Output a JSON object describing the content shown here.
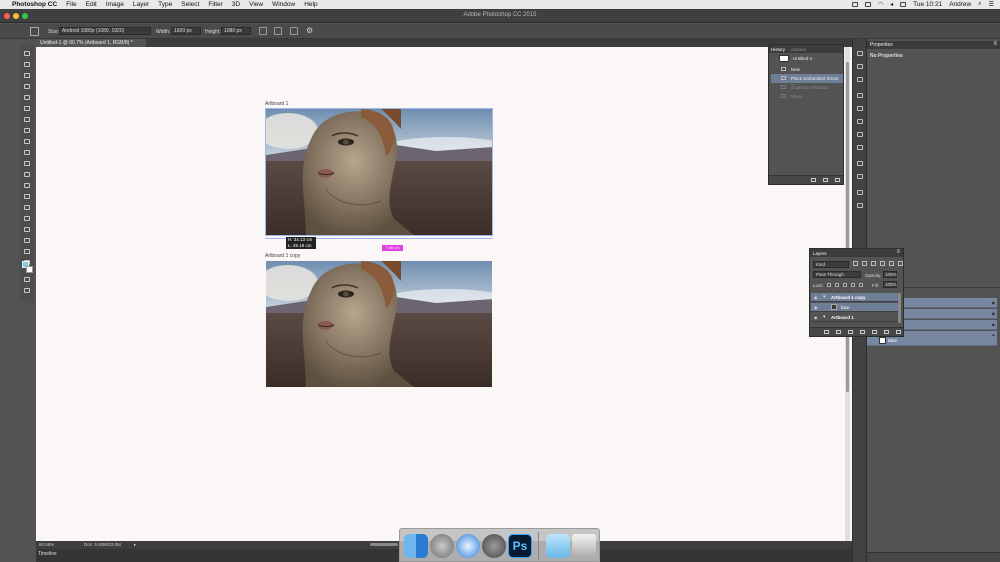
{
  "menubar": {
    "apple_icon": "apple-logo-icon",
    "items": [
      "Photoshop CC",
      "File",
      "Edit",
      "Image",
      "Layer",
      "Type",
      "Select",
      "Filter",
      "3D",
      "View",
      "Window",
      "Help"
    ],
    "clock": "Tue 10:21",
    "user": "Andrew"
  },
  "window": {
    "title": "Adobe Photoshop CC 2015",
    "traffic_colors": [
      "#fc605c",
      "#fdbc40",
      "#34c84a"
    ]
  },
  "options_bar": {
    "size_label": "Size:",
    "size_value": "Android 1080p (1080, 1920)",
    "width_label": "Width:",
    "width_value": "1920 px",
    "height_label": "Height:",
    "height_value": "1080 px"
  },
  "document_tab": {
    "title": "Untitled-1 @ 60.7% (Artboard 1, RGB/8) *"
  },
  "canvas": {
    "artboard1_label": "Artboard 1",
    "artboard2_label": "Artboard 1 copy",
    "measure_line1": "H: 34.13 cm",
    "measure_line2": "L: 45.19 cm",
    "guide_label": "7.06 cm",
    "selection_color": "#9fb7e8",
    "guide_color": "#e23ee2"
  },
  "history": {
    "tab_history": "History",
    "tab_actions": "Actions",
    "snapshot": "Untitled-1",
    "items": [
      {
        "label": "New",
        "state": "normal"
      },
      {
        "label": "Place Embedded Smart ...",
        "state": "selected"
      },
      {
        "label": "Duplicate Artboard",
        "state": "dim"
      },
      {
        "label": "Move",
        "state": "dim"
      }
    ]
  },
  "layers": {
    "title": "Layers",
    "kind": "Kind",
    "blend_mode": "Pass Through",
    "opacity_label": "Opacity:",
    "opacity_value": "100%",
    "lock_label": "Lock:",
    "fill_label": "Fill:",
    "fill_value": "100%",
    "rows": [
      {
        "label": "Artboard 1 copy",
        "selected": true,
        "type": "group"
      },
      {
        "label": "face",
        "selected": true,
        "type": "smart"
      },
      {
        "label": "Artboard 1",
        "selected": false,
        "type": "group"
      }
    ]
  },
  "properties": {
    "title": "Properties",
    "body": "No Properties",
    "bg_layer_labels": [
      "",
      "",
      "",
      "",
      "Blue"
    ]
  },
  "status": {
    "zoom": "60.65%",
    "doc": "Doc: 5.93M/23.0M"
  },
  "timeline": {
    "label": "Timeline"
  },
  "dock": {
    "apps": [
      "finder-icon",
      "launchpad-icon",
      "safari-icon",
      "system-preferences-icon",
      "photoshop-icon",
      "downloads-folder-icon",
      "trash-icon"
    ],
    "ps_label": "Ps"
  }
}
